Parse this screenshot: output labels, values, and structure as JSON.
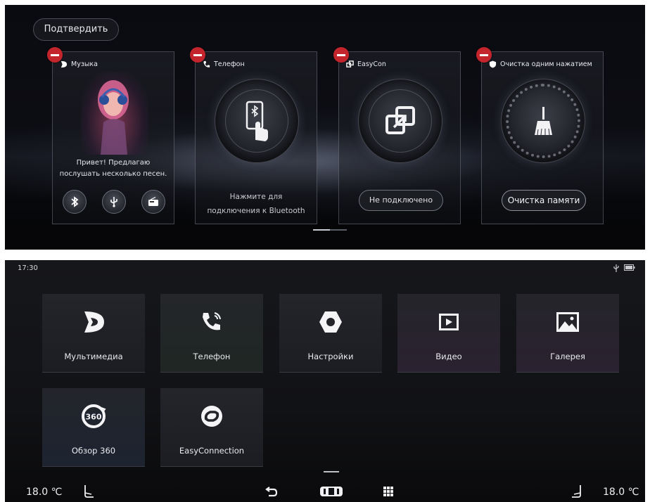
{
  "top": {
    "confirm_label": "Подтвердить",
    "cards": [
      {
        "title": "Музыка",
        "text_line1": "Привет! Предлагаю",
        "text_line2": "послушать несколько песен.",
        "buttons": [
          "bluetooth-icon",
          "usb-icon",
          "radio-icon"
        ]
      },
      {
        "title": "Телефон",
        "caption_line1": "Нажмите для",
        "caption_line2": "подключения к Bluetooth"
      },
      {
        "title": "EasyCon",
        "status": "Не подключено"
      },
      {
        "title": "Очистка одним нажатием",
        "action": "Очистка памяти"
      }
    ],
    "accent_color": "#c4252d"
  },
  "bottom": {
    "time": "17:30",
    "apps": [
      {
        "label": "Мультимедиа",
        "icon": "multimedia-icon"
      },
      {
        "label": "Телефон",
        "icon": "phone-icon"
      },
      {
        "label": "Настройки",
        "icon": "settings-icon"
      },
      {
        "label": "Видео",
        "icon": "video-icon"
      },
      {
        "label": "Галерея",
        "icon": "gallery-icon"
      },
      {
        "label": "Обзор 360",
        "icon": "view-360-icon",
        "icon_text": "360"
      },
      {
        "label": "EasyConnection",
        "icon": "easyconnection-icon"
      }
    ],
    "dock": {
      "temp_left": "18.0 ℃",
      "temp_right": "18.0 ℃",
      "icons": [
        "seat-left-icon",
        "back-icon",
        "car-fan-icon",
        "app-grid-icon",
        "seat-right-icon"
      ]
    }
  }
}
